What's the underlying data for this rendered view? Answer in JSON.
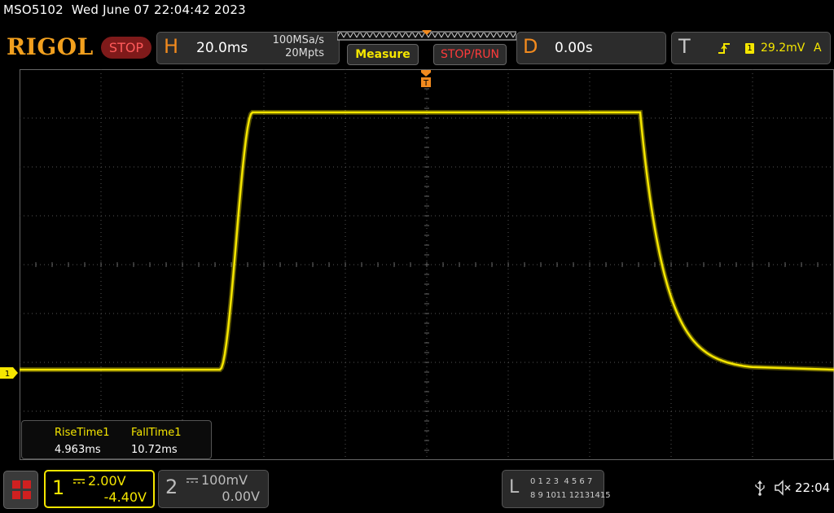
{
  "header": {
    "model": "MSO5102",
    "datetime": "Wed June 07 22:04:42 2023",
    "brand": "RIGOL",
    "run_state": "STOP"
  },
  "horizontal": {
    "letter": "H",
    "time_scale": "20.0ms",
    "sample_rate": "100MSa/s",
    "memory_depth": "20Mpts"
  },
  "buttons": {
    "measure": "Measure",
    "stop_run": "STOP/RUN"
  },
  "delay": {
    "letter": "D",
    "value": "0.00s"
  },
  "trigger": {
    "letter": "T",
    "source": "1",
    "level": "29.2mV",
    "mode": "A"
  },
  "measurements": [
    {
      "label": "RiseTime1",
      "value": "4.963ms"
    },
    {
      "label": "FallTime1",
      "value": "10.72ms"
    }
  ],
  "channels": [
    {
      "number": "1",
      "scale": "2.00V",
      "offset": "-4.40V",
      "active": true
    },
    {
      "number": "2",
      "scale": "100mV",
      "offset": "0.00V",
      "active": false
    }
  ],
  "logic_analyzer": {
    "letter": "L",
    "row1": "0 1 2 3  4 5 6 7",
    "row2": "8 9 1011 12131415"
  },
  "status": {
    "time": "22:04"
  },
  "colors": {
    "ch1": "#f5e600",
    "accent_orange": "#f28a1e",
    "stop_red": "#ff3b3b",
    "background": "#000000",
    "grid": "#555555"
  },
  "icons": [
    "menu-icon",
    "usb-icon",
    "sound-muted-icon",
    "trigger-rising-edge-icon",
    "trigger-position-icon",
    "channel-1-marker-icon",
    "dc-coupling-icon"
  ]
}
